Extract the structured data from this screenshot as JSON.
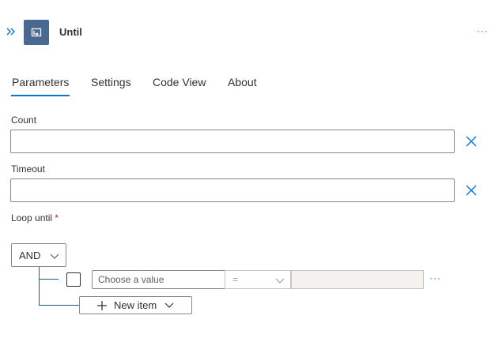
{
  "header": {
    "title": "Until",
    "more_label": "···"
  },
  "tabs": [
    {
      "label": "Parameters",
      "active": true
    },
    {
      "label": "Settings",
      "active": false
    },
    {
      "label": "Code View",
      "active": false
    },
    {
      "label": "About",
      "active": false
    }
  ],
  "fields": {
    "count": {
      "label": "Count",
      "value": ""
    },
    "timeout": {
      "label": "Timeout",
      "value": ""
    },
    "loop_until": {
      "label": "Loop until",
      "required_mark": "*"
    }
  },
  "condition": {
    "group_operator": "AND",
    "row": {
      "value_placeholder": "Choose a value",
      "operator": "=",
      "more_label": "···"
    },
    "new_item_label": "New item"
  },
  "colors": {
    "accent": "#0078d4",
    "action_tile": "#486991",
    "required": "#a4262c"
  }
}
